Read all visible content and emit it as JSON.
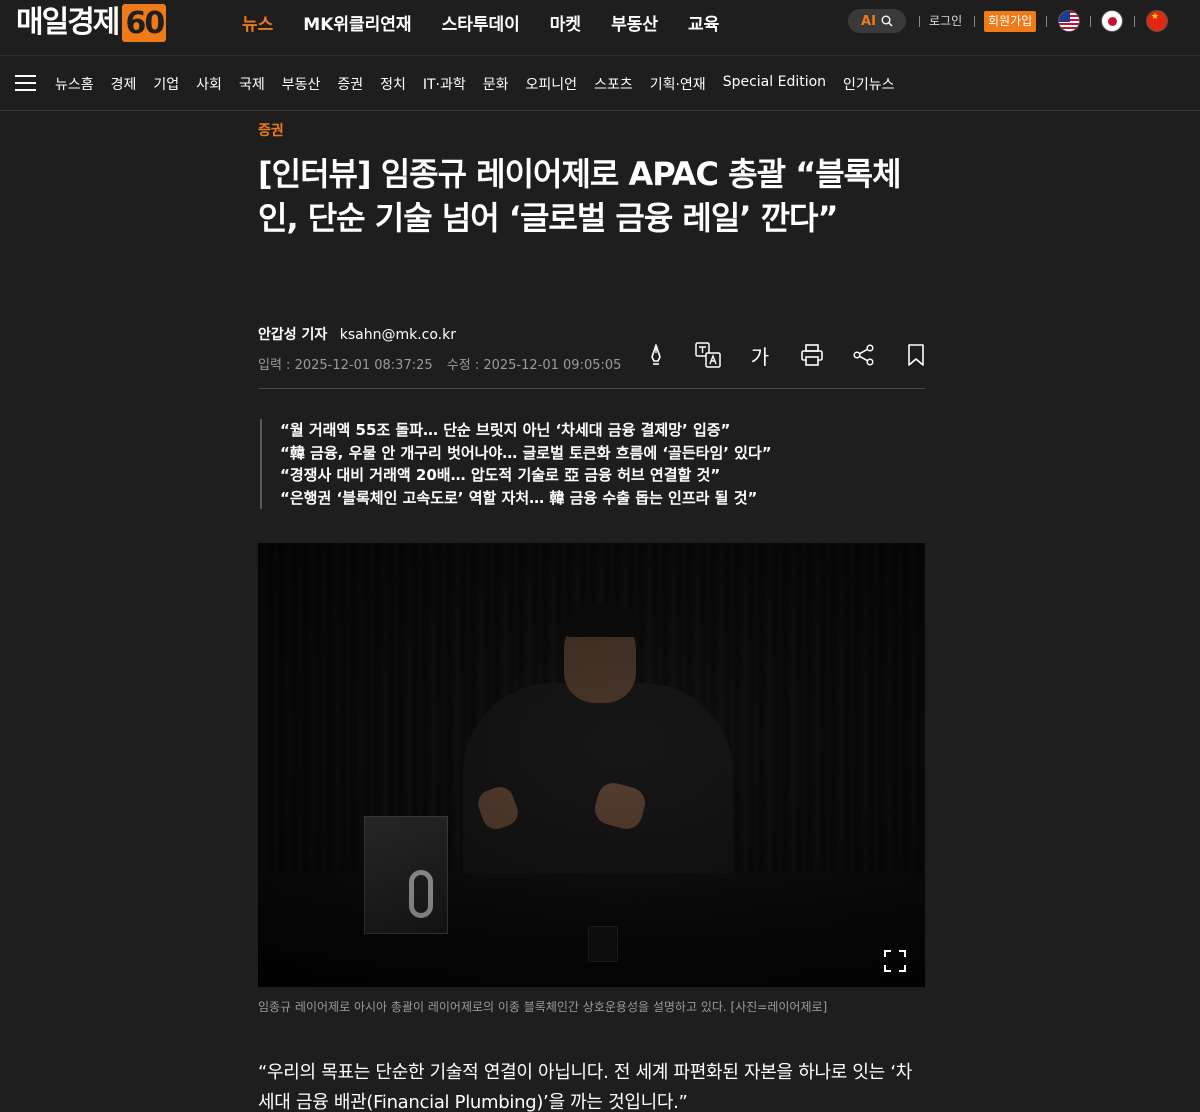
{
  "header": {
    "logo_text": "매일경제",
    "logo_badge": "60",
    "nav": [
      {
        "label": "뉴스",
        "active": true
      },
      {
        "label": "MK위클리연재",
        "active": false
      },
      {
        "label": "스타투데이",
        "active": false
      },
      {
        "label": "마켓",
        "active": false
      },
      {
        "label": "부동산",
        "active": false
      },
      {
        "label": "교육",
        "active": false
      }
    ],
    "ai_label": "AI",
    "login": "로그인",
    "signup": "회원가입",
    "accent": "#ef7a1a"
  },
  "subnav": {
    "items": [
      "뉴스홈",
      "경제",
      "기업",
      "사회",
      "국제",
      "부동산",
      "증권",
      "정치",
      "IT·과학",
      "문화",
      "오피니언",
      "스포츠",
      "기획·연재",
      "Special Edition",
      "인기뉴스"
    ]
  },
  "article": {
    "category": "증권",
    "headline": "[인터뷰] 임종규 레이어제로 APAC 총괄 “블록체인, 단순 기술 넘어 ‘글로벌 금융 레일’ 깐다”",
    "reporter": "안갑성 기자",
    "email": "ksahn@mk.co.kr",
    "published": "입력 : 2025-12-01 08:37:25",
    "modified": "수정 : 2025-12-01 09:05:05",
    "font_tool_label": "가",
    "summary": [
      "“월 거래액 55조 돌파… 단순 브릿지 아닌 ‘차세대 금융 결제망’ 입증”",
      "“韓 금융, 우물 안 개구리 벗어나야… 글로벌 토큰화 흐름에 ‘골든타임’ 있다”",
      "“경쟁사 대비 거래액 20배… 압도적 기술로 亞 금융 허브 연결할 것”",
      "“은행권 ‘블록체인 고속도로’ 역할 자처… 韓 금융 수출 돕는 인프라 될 것”"
    ],
    "caption": "임종규 레이어제로 아시아 총괄이 레이어제로의 이종 블록체인간 상호운용성을 설명하고 있다. [사진=레이어제로]",
    "body_quote": "“우리의 목표는 단순한 기술적 연결이 아닙니다. 전 세계 파편화된 자본을 하나로 잇는 ‘차세대 금융 배관(Financial Plumbing)’을 까는 것입니다.”"
  },
  "icons": {
    "tools": [
      "highlight-pen-icon",
      "translate-icon",
      "font-size-icon",
      "print-icon",
      "share-icon",
      "bookmark-icon"
    ],
    "photo": [
      "expand-icon"
    ]
  }
}
